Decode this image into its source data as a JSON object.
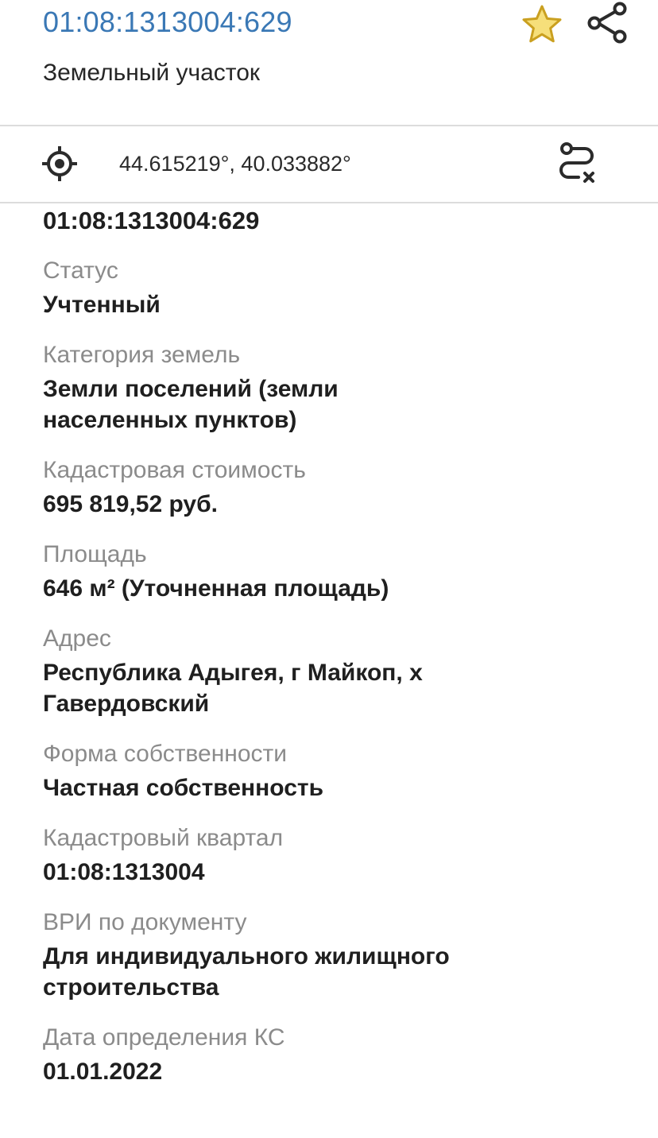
{
  "header": {
    "cadastral_number": "01:08:1313004:629",
    "object_type": "Земельный участок",
    "icons": {
      "favorite": "star-icon",
      "share": "share-icon"
    },
    "colors": {
      "link": "#3a78b5",
      "star": "#d9a820"
    }
  },
  "coordinates": {
    "text": "44.615219°, 40.033882°",
    "icons": {
      "locate": "target-icon",
      "route": "route-icon"
    }
  },
  "details": {
    "cadastral_number": "01:08:1313004:629",
    "fields": [
      {
        "label": "Статус",
        "value": "Учтенный"
      },
      {
        "label": "Категория земель",
        "value": "Земли поселений (земли\nнаселенных пунктов)"
      },
      {
        "label": "Кадастровая стоимость",
        "value": "695 819,52 руб."
      },
      {
        "label": "Площадь",
        "value": "646 м² (Уточненная площадь)"
      },
      {
        "label": "Адрес",
        "value": "Республика Адыгея, г Майкоп, х\nГавердовский"
      },
      {
        "label": "Форма собственности",
        "value": "Частная собственность"
      },
      {
        "label": "Кадастровый квартал",
        "value": "01:08:1313004"
      },
      {
        "label": "ВРИ по документу",
        "value": "Для индивидуального жилищного\nстроительства"
      },
      {
        "label": "Дата определения КС",
        "value": "01.01.2022"
      }
    ]
  }
}
